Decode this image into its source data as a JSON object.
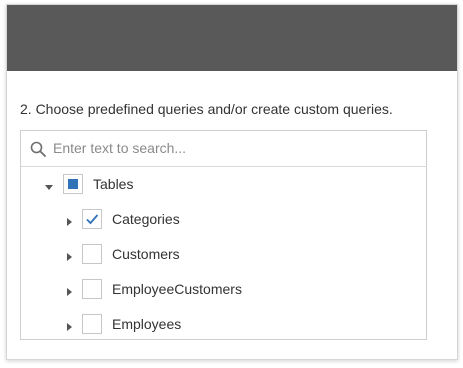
{
  "step": {
    "title": "2. Choose predefined queries and/or create custom queries."
  },
  "search": {
    "placeholder": "Enter text to search...",
    "value": ""
  },
  "tree": {
    "root": {
      "label": "Tables",
      "expanded": true,
      "check_state": "indeterminate"
    },
    "items": [
      {
        "label": "Categories",
        "expanded": false,
        "check_state": "checked"
      },
      {
        "label": "Customers",
        "expanded": false,
        "check_state": "unchecked"
      },
      {
        "label": "EmployeeCustomers",
        "expanded": false,
        "check_state": "unchecked"
      },
      {
        "label": "Employees",
        "expanded": false,
        "check_state": "unchecked"
      }
    ]
  },
  "colors": {
    "header_bar": "#595959",
    "accent": "#2f72b8",
    "text": "#333333"
  },
  "icons": {
    "search": "search-icon",
    "expand": "triangle-right-icon",
    "collapse": "triangle-down-icon",
    "check": "checkmark-icon"
  }
}
